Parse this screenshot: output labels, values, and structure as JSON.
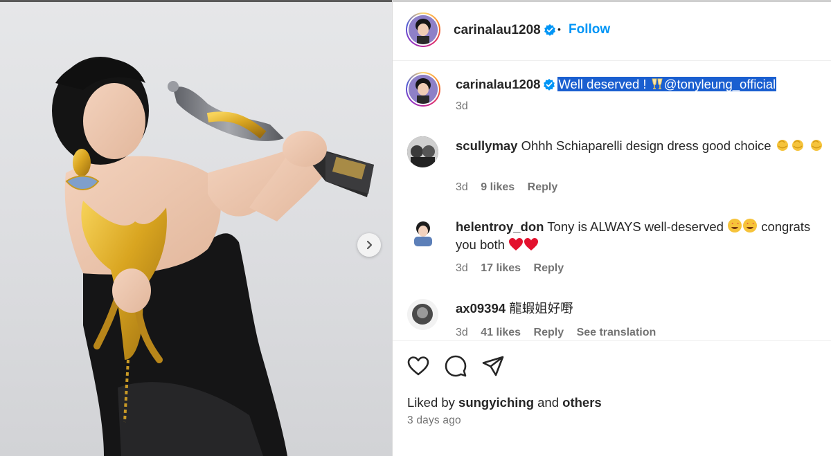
{
  "post": {
    "username": "carinalau1208",
    "follow_label": "Follow",
    "separator": "•"
  },
  "caption": {
    "username": "carinalau1208",
    "text_before": "Well deserved ! ",
    "mention": "@tonyleung_official",
    "time": "3d"
  },
  "comments": [
    {
      "username": "scullymay",
      "text": "Ohhh Schiaparelli design dress good choice",
      "time": "3d",
      "likes": "9 likes",
      "reply": "Reply"
    },
    {
      "username": "helentroy_don",
      "text": "Tony is ALWAYS well-deserved",
      "text_after": "congrats you both",
      "time": "3d",
      "likes": "17 likes",
      "reply": "Reply"
    },
    {
      "username": "ax09394",
      "text": "龍蝦姐好嘢",
      "time": "3d",
      "likes": "41 likes",
      "reply": "Reply",
      "translate": "See translation"
    }
  ],
  "likes": {
    "prefix": "Liked by",
    "user": "sungyiching",
    "conj": "and",
    "others": "others"
  },
  "posted_ago": "3 days ago",
  "icons": [
    "like-icon",
    "comment-icon",
    "share-icon",
    "verified-icon",
    "chevron-right-icon"
  ],
  "colors": {
    "accent": "#0095f6",
    "verified": "#0095f6",
    "selection": "#1a5fd0",
    "muted": "#737373"
  }
}
